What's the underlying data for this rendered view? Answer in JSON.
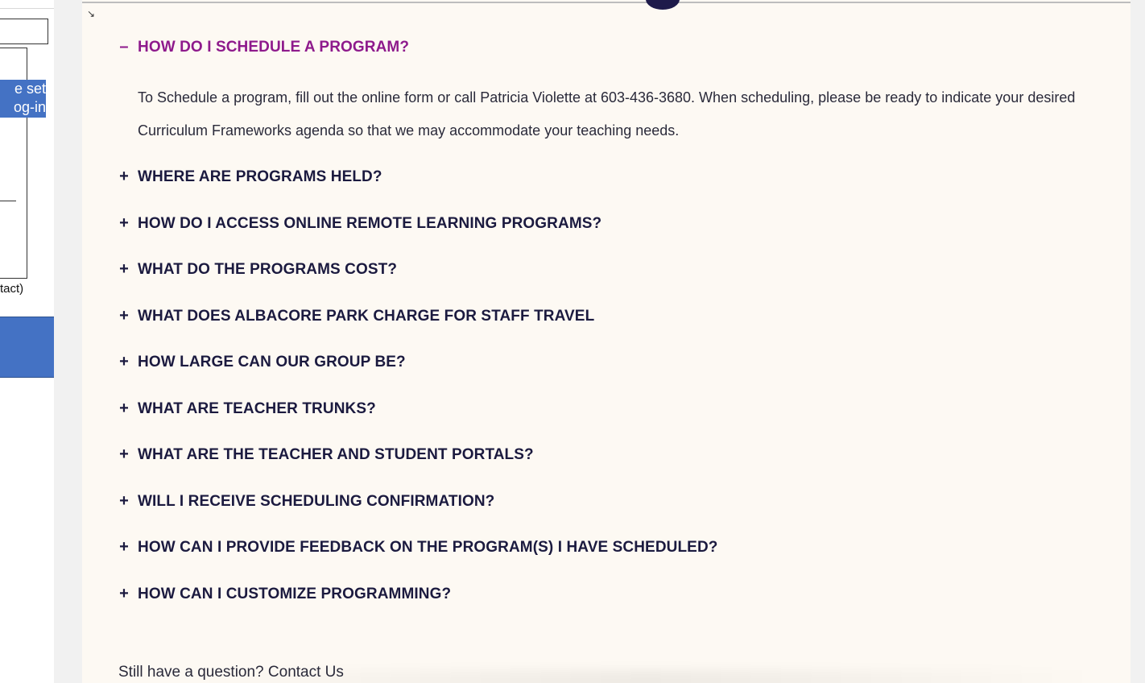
{
  "left_panel": {
    "callout_line1": "e set",
    "callout_line2": "og-in",
    "note": "tact)"
  },
  "faq": {
    "open_item": {
      "toggle": "–",
      "question": "HOW DO I SCHEDULE A PROGRAM?",
      "answer": "To Schedule a program, fill out the online form or call Patricia Violette at 603-436-3680. When scheduling, please be ready to indicate your desired Curriculum Frameworks agenda so that we may accommodate your teaching needs."
    },
    "collapsed_toggle": "+",
    "items": [
      {
        "question": "WHERE ARE PROGRAMS HELD?"
      },
      {
        "question": "HOW DO I ACCESS ONLINE REMOTE LEARNING PROGRAMS?"
      },
      {
        "question": "WHAT DO THE PROGRAMS COST?"
      },
      {
        "question": "WHAT DOES ALBACORE PARK CHARGE FOR STAFF TRAVEL"
      },
      {
        "question": "HOW LARGE CAN OUR GROUP BE?"
      },
      {
        "question": "WHAT ARE TEACHER TRUNKS?"
      },
      {
        "question": "WHAT ARE THE TEACHER AND STUDENT PORTALS?"
      },
      {
        "question": "WILL I RECEIVE SCHEDULING CONFIRMATION?"
      },
      {
        "question": "HOW CAN I PROVIDE FEEDBACK ON THE PROGRAM(S) I HAVE SCHEDULED?"
      },
      {
        "question": "HOW CAN I CUSTOMIZE PROGRAMMING?"
      }
    ]
  },
  "footer": {
    "text": "Still have a question? Contact Us"
  },
  "colors": {
    "open_question": "#8e1a8c",
    "question": "#1b1a3f",
    "page_background": "#fdf9f3",
    "callout": "#4472c4"
  },
  "icons": {
    "corner": "resize-arrow-icon"
  }
}
